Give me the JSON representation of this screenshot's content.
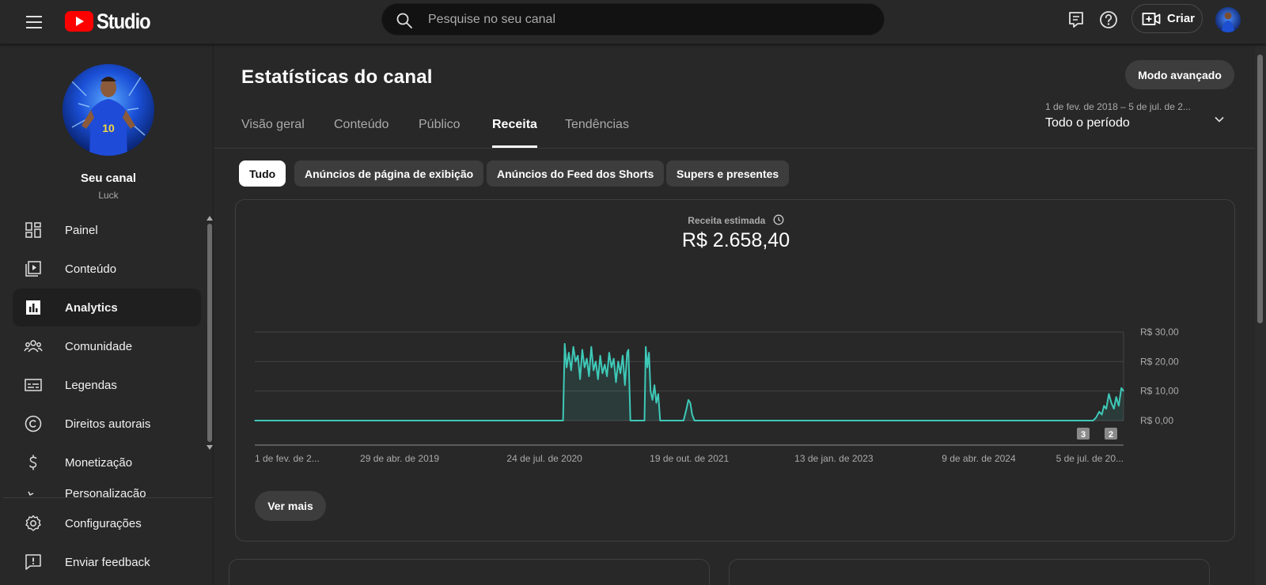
{
  "topbar": {
    "logo_text": "Studio",
    "search_placeholder": "Pesquise no seu canal",
    "create_label": "Criar"
  },
  "sidebar": {
    "channel_name": "Seu canal",
    "channel_handle": "Luck",
    "items": [
      {
        "label": "Painel",
        "icon": "dashboard-icon"
      },
      {
        "label": "Conteúdo",
        "icon": "content-icon"
      },
      {
        "label": "Analytics",
        "icon": "analytics-icon",
        "active": true
      },
      {
        "label": "Comunidade",
        "icon": "community-icon"
      },
      {
        "label": "Legendas",
        "icon": "subtitles-icon"
      },
      {
        "label": "Direitos autorais",
        "icon": "copyright-icon"
      },
      {
        "label": "Monetização",
        "icon": "dollar-icon"
      },
      {
        "label": "Personalização",
        "icon": "customization-icon"
      }
    ],
    "bottom_items": [
      {
        "label": "Configurações",
        "icon": "gear-icon"
      },
      {
        "label": "Enviar feedback",
        "icon": "feedback-icon"
      }
    ]
  },
  "main": {
    "title": "Estatísticas do canal",
    "advanced_mode": "Modo avançado",
    "date_range": "1 de fev. de 2018 – 5 de jul. de 2...",
    "period_label": "Todo o período",
    "tabs": [
      {
        "label": "Visão geral"
      },
      {
        "label": "Conteúdo"
      },
      {
        "label": "Público"
      },
      {
        "label": "Receita",
        "active": true
      },
      {
        "label": "Tendências"
      }
    ],
    "chips": [
      {
        "label": "Tudo",
        "active": true
      },
      {
        "label": "Anúncios de página de exibição"
      },
      {
        "label": "Anúncios do Feed dos Shorts"
      },
      {
        "label": "Supers e presentes"
      }
    ],
    "metric_label": "Receita estimada",
    "metric_value": "R$ 2.658,40",
    "see_more": "Ver mais"
  },
  "chart_data": {
    "type": "area",
    "y_tick_labels": [
      "R$ 0,00",
      "R$ 10,00",
      "R$ 20,00",
      "R$ 30,00"
    ],
    "y_ticks": [
      0,
      10,
      20,
      30
    ],
    "ylim": [
      0,
      30
    ],
    "x_tick_labels": [
      "1 de fev. de 2...",
      "29 de abr. de 2019",
      "24 de jul. de 2020",
      "19 de out. de 2021",
      "13 de jan. de 2023",
      "9 de abr. de 2024",
      "5 de jul. de 20..."
    ],
    "x_ticks": [
      "2018-02-01",
      "2019-04-29",
      "2020-07-24",
      "2021-10-19",
      "2023-01-13",
      "2024-04-09",
      "2025-07-05"
    ],
    "color": "#3ec9b8",
    "series": [
      {
        "x": [
          "2018-02-01",
          "2020-09-20",
          "2020-09-25",
          "2020-10-01",
          "2020-10-08",
          "2020-10-15",
          "2020-10-22",
          "2020-10-29",
          "2020-11-05",
          "2020-11-12",
          "2020-11-19",
          "2020-11-26",
          "2020-12-03",
          "2020-12-10",
          "2020-12-17",
          "2020-12-24",
          "2020-12-31",
          "2021-01-07",
          "2021-01-14",
          "2021-01-21",
          "2021-01-28",
          "2021-02-04",
          "2021-02-11",
          "2021-02-18",
          "2021-02-25",
          "2021-03-04",
          "2021-03-11",
          "2021-03-18",
          "2021-03-25",
          "2021-04-01",
          "2021-04-08",
          "2021-04-12",
          "2021-04-18",
          "2021-05-01",
          "2021-06-01",
          "2021-06-05",
          "2021-06-10",
          "2021-06-15",
          "2021-06-20",
          "2021-06-26",
          "2021-07-02",
          "2021-07-08",
          "2021-07-14",
          "2021-07-20",
          "2021-07-24",
          "2021-08-01",
          "2021-10-01",
          "2021-10-10",
          "2021-10-16",
          "2021-10-22",
          "2021-10-28",
          "2021-11-04",
          "2025-03-20",
          "2025-04-01",
          "2025-04-10",
          "2025-04-20",
          "2025-04-28",
          "2025-05-05",
          "2025-05-12",
          "2025-05-20",
          "2025-05-28",
          "2025-06-05",
          "2025-06-12",
          "2025-06-20",
          "2025-06-28",
          "2025-07-05"
        ],
        "values": [
          0,
          0,
          26,
          18,
          23,
          17,
          25,
          20,
          22,
          14,
          24,
          18,
          21,
          15,
          25,
          17,
          20,
          14,
          22,
          16,
          19,
          15,
          23,
          18,
          21,
          13,
          20,
          16,
          22,
          12,
          23,
          24,
          0,
          0,
          0,
          25,
          18,
          23,
          10,
          7,
          12,
          6,
          9,
          0,
          0,
          0,
          0,
          4,
          7,
          6,
          2,
          0,
          0,
          0,
          1,
          3,
          2,
          5,
          4,
          9,
          6,
          4,
          8,
          5,
          11,
          10
        ]
      }
    ],
    "annotations": [
      "3",
      "2"
    ],
    "grid": true
  }
}
